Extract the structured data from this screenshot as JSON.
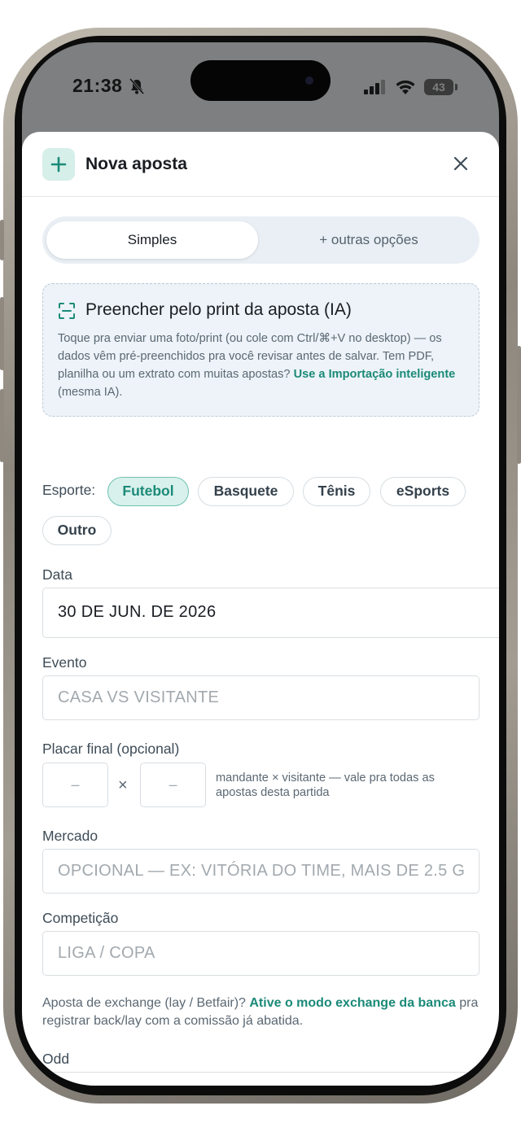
{
  "status_bar": {
    "time": "21:38",
    "battery": "43"
  },
  "sheet": {
    "title": "Nova aposta",
    "tabs": [
      {
        "label": "Simples"
      },
      {
        "label": "+ outras opções"
      }
    ],
    "ai": {
      "title": "Preencher pelo print da aposta (IA)",
      "desc_part1": "Toque pra enviar uma foto/print (ou cole com Ctrl/⌘+V no desktop) — os dados vêm pré-preenchidos pra você revisar antes de salvar. Tem PDF, planilha ou um extrato com muitas apostas? ",
      "desc_link": "Use a Importação inteligente",
      "desc_part2": " (mesma IA)."
    },
    "sport": {
      "label": "Esporte:",
      "options": [
        "Futebol",
        "Basquete",
        "Tênis",
        "eSports",
        "Outro"
      ],
      "selected": "Futebol"
    },
    "date": {
      "label": "Data",
      "value": "30 DE JUN. DE 2026"
    },
    "event": {
      "label": "Evento",
      "placeholder": "CASA VS VISITANTE"
    },
    "score": {
      "label": "Placar final (opcional)",
      "home_placeholder": "–",
      "away_placeholder": "–",
      "separator": "×",
      "hint": "mandante × visitante — vale pra todas as apostas desta partida"
    },
    "market": {
      "label": "Mercado",
      "placeholder": "OPCIONAL — EX: VITÓRIA DO TIME, MAIS DE 2.5 G"
    },
    "competition": {
      "label": "Competição",
      "placeholder": "LIGA / COPA"
    },
    "exchange": {
      "part1": "Aposta de exchange (lay / Betfair)? ",
      "link": "Ative o modo exchange da banca",
      "part2": " pra registrar back/lay com a comissão já abatida."
    },
    "odd": {
      "label": "Odd"
    }
  },
  "colors": {
    "accent": "#1b8a78",
    "accent_bg": "#d9f1ec",
    "text": "#1a1d22",
    "muted": "#5b6873"
  }
}
